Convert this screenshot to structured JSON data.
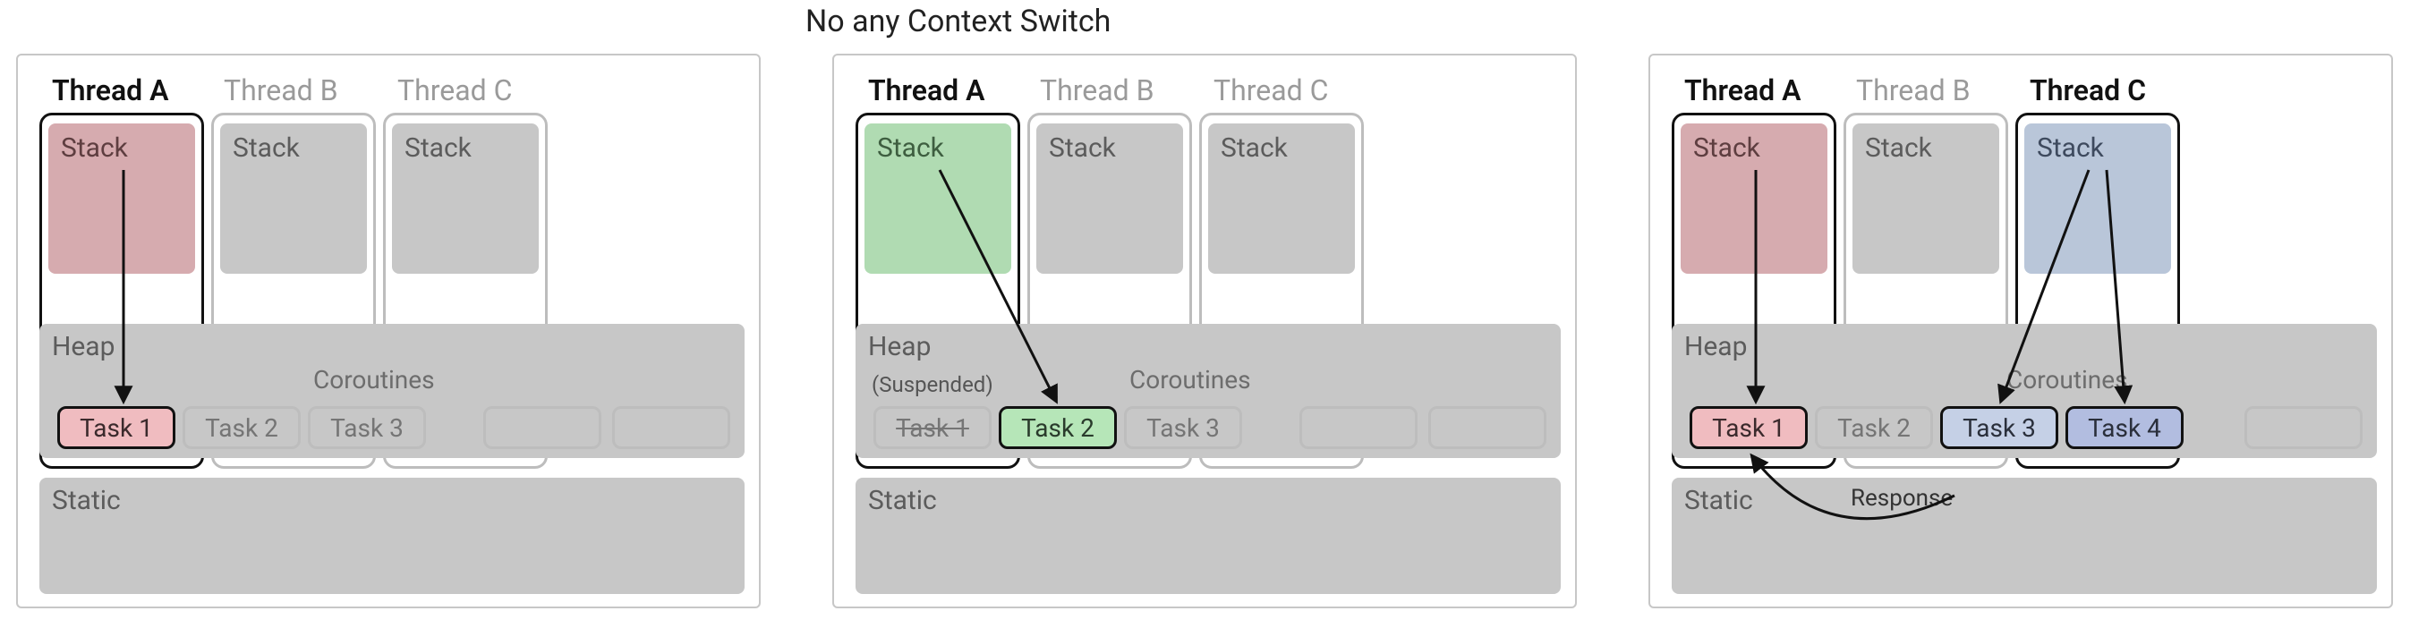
{
  "title": "No any Context Switch",
  "labels": {
    "threadA": "Thread A",
    "threadB": "Thread B",
    "threadC": "Thread C",
    "stack": "Stack",
    "heap": "Heap",
    "static": "Static",
    "coroutines": "Coroutines",
    "suspended": "(Suspended)",
    "response": "Response"
  },
  "tasks": {
    "task1": "Task 1",
    "task2": "Task 2",
    "task3": "Task 3",
    "task4": "Task 4"
  },
  "chart_data": {
    "type": "table",
    "title": "No any Context Switch",
    "description": "Three snapshots of a process with threads A/B/C each having a Stack, a shared Heap containing coroutine task slots, and a Static region. Arrows show which thread stack is executing which coroutine task.",
    "snapshots": [
      {
        "index": 1,
        "threads": [
          {
            "name": "Thread A",
            "active": true,
            "stack_color": "red"
          },
          {
            "name": "Thread B",
            "active": false,
            "stack_color": "gray"
          },
          {
            "name": "Thread C",
            "active": false,
            "stack_color": "gray"
          }
        ],
        "tasks": [
          {
            "name": "Task 1",
            "state": "running",
            "executed_by": "Thread A",
            "color": "red"
          },
          {
            "name": "Task 2",
            "state": "idle",
            "color": "gray"
          },
          {
            "name": "Task 3",
            "state": "idle",
            "color": "gray"
          },
          {
            "name": "",
            "state": "empty",
            "color": "gray"
          },
          {
            "name": "",
            "state": "empty",
            "color": "gray"
          }
        ],
        "arrows": [
          {
            "from": "Thread A Stack",
            "to": "Task 1"
          }
        ]
      },
      {
        "index": 2,
        "threads": [
          {
            "name": "Thread A",
            "active": true,
            "stack_color": "green"
          },
          {
            "name": "Thread B",
            "active": false,
            "stack_color": "gray"
          },
          {
            "name": "Thread C",
            "active": false,
            "stack_color": "gray"
          }
        ],
        "tasks": [
          {
            "name": "Task 1",
            "state": "suspended",
            "color": "gray",
            "strikethrough": true
          },
          {
            "name": "Task 2",
            "state": "running",
            "executed_by": "Thread A",
            "color": "green"
          },
          {
            "name": "Task 3",
            "state": "idle",
            "color": "gray"
          },
          {
            "name": "",
            "state": "empty",
            "color": "gray"
          },
          {
            "name": "",
            "state": "empty",
            "color": "gray"
          }
        ],
        "arrows": [
          {
            "from": "Thread A Stack",
            "to": "Task 2"
          }
        ]
      },
      {
        "index": 3,
        "threads": [
          {
            "name": "Thread A",
            "active": true,
            "stack_color": "red"
          },
          {
            "name": "Thread B",
            "active": false,
            "stack_color": "gray"
          },
          {
            "name": "Thread C",
            "active": true,
            "stack_color": "blue"
          }
        ],
        "tasks": [
          {
            "name": "Task 1",
            "state": "running",
            "executed_by": "Thread A",
            "color": "red",
            "note": "Resumed on Response"
          },
          {
            "name": "Task 2",
            "state": "idle",
            "color": "gray"
          },
          {
            "name": "Task 3",
            "state": "running",
            "executed_by": "Thread C",
            "color": "blue"
          },
          {
            "name": "Task 4",
            "state": "running",
            "executed_by": "Thread C",
            "color": "blue"
          },
          {
            "name": "",
            "state": "empty",
            "color": "gray"
          }
        ],
        "arrows": [
          {
            "from": "Thread A Stack",
            "to": "Task 1"
          },
          {
            "from": "Thread C Stack",
            "to": "Task 3"
          },
          {
            "from": "Thread C Stack",
            "to": "Task 4"
          },
          {
            "from": "Response",
            "to": "Task 1",
            "curved": true
          }
        ]
      }
    ]
  }
}
